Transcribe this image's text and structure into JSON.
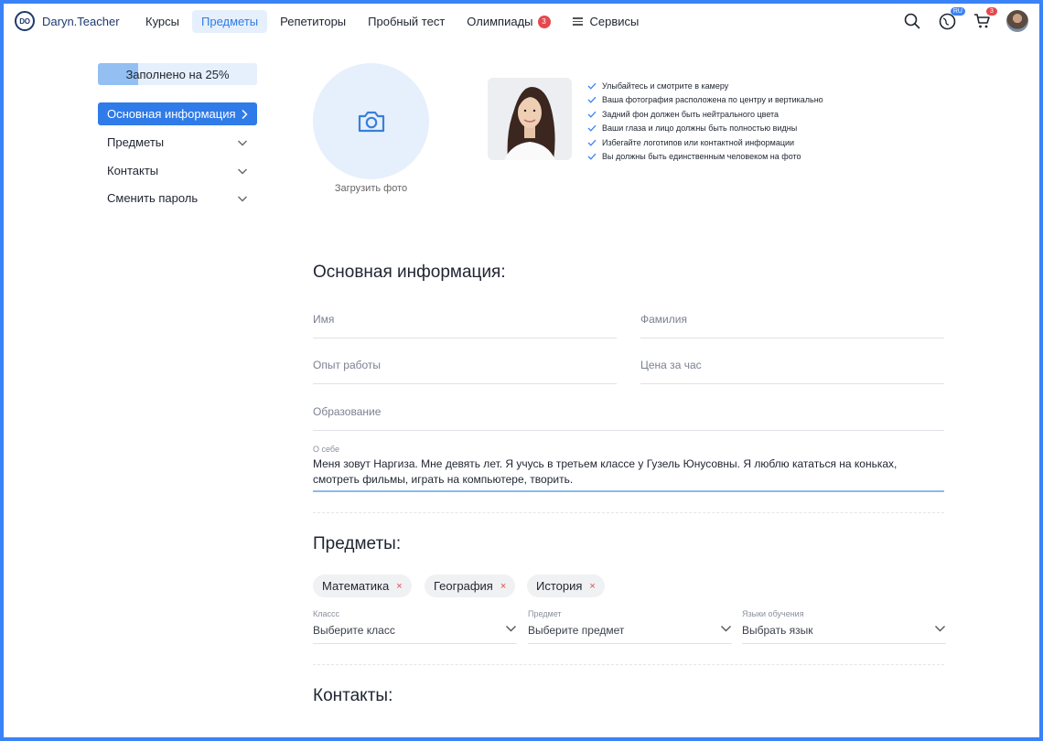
{
  "header": {
    "logo_mark": "DO",
    "logo_text": "Daryn.Teacher",
    "nav": [
      {
        "label": "Курсы"
      },
      {
        "label": "Предметы"
      },
      {
        "label": "Репетиторы"
      },
      {
        "label": "Пробный тест"
      },
      {
        "label": "Олимпиады",
        "badge": "3"
      },
      {
        "label": "Сервисы"
      }
    ],
    "lang_badge": "RU",
    "cart_badge": "3",
    "icons": [
      "search-icon",
      "globe-icon",
      "cart-icon",
      "avatar"
    ]
  },
  "sidebar": {
    "progress_label": "Заполнено на 25%",
    "progress_fraction": 0.25,
    "items": [
      {
        "label": "Основная информация",
        "icon": "chevron-right-icon"
      },
      {
        "label": "Предметы",
        "icon": "chevron-down-icon"
      },
      {
        "label": "Контакты",
        "icon": "chevron-down-icon"
      },
      {
        "label": "Сменить пароль",
        "icon": "chevron-down-icon"
      }
    ]
  },
  "photo": {
    "upload_label": "Загрузить фото",
    "tips": [
      "Улыбайтесь и смотрите в камеру",
      "Ваша фотография расположена по центру и вертикально",
      "Задний фон должен быть нейтрального цвета",
      "Ваши глаза и лицо должны быть полностью видны",
      "Избегайте логотипов или контактной информации",
      "Вы должны быть единственным человеком на фото"
    ]
  },
  "basic_info": {
    "title": "Основная информация:",
    "first_name_placeholder": "Имя",
    "last_name_placeholder": "Фамилия",
    "experience_placeholder": "Опыт работы",
    "price_placeholder": "Цена за час",
    "education_placeholder": "Образование",
    "about_label": "О себе",
    "about_value": "Меня зовут Наргиза. Мне девять лет. Я учусь в третьем классе у Гузель Юнусовны. Я люблю кататься на коньках, смотреть фильмы, играть на компьютере, творить."
  },
  "subjects": {
    "title": "Предметы:",
    "chips": [
      "Математика",
      "География",
      "История"
    ],
    "remove_glyph": "×",
    "class_label": "Класcс",
    "class_value": "Выберите класс",
    "subject_label": "Предмет",
    "subject_value": "Выберите предмет",
    "language_label": "Языки обучения",
    "language_value": "Выбрать язык"
  },
  "contacts": {
    "title": "Контакты:"
  },
  "colors": {
    "accent": "#2f7be8",
    "frame": "#3b82f6",
    "light_blue": "#e6f0fc",
    "badge_red": "#e5484d"
  }
}
